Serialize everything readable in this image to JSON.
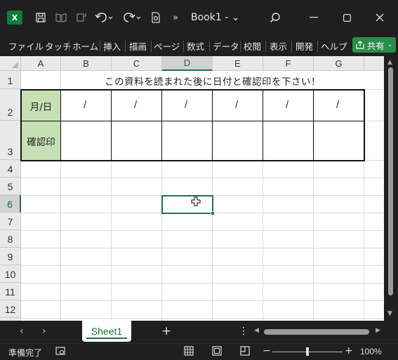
{
  "window": {
    "title": "Book1",
    "title_suffix": "- ⌄",
    "app_letter": "X"
  },
  "ribbon": {
    "tabs": [
      "ファイル",
      "タッチ",
      "ホーム",
      "挿入",
      "描画",
      "ページ",
      "数式",
      "データ",
      "校閲",
      "表示",
      "開発",
      "ヘルプ"
    ],
    "share_label": "共有"
  },
  "columns": [
    "A",
    "B",
    "C",
    "D",
    "E",
    "F",
    "G"
  ],
  "rows": [
    "1",
    "2",
    "3",
    "4",
    "5",
    "6",
    "7",
    "8",
    "9",
    "10",
    "11",
    "12"
  ],
  "selected_column": "D",
  "selected_row": "6",
  "cells": {
    "title_row": "この資料を読まれた後に日付と確認印を下さい！",
    "date_label": "月/日",
    "confirm_label": "確認印",
    "date_slash": "/"
  },
  "colors": {
    "accent": "#217346",
    "label_fill": "#c6e0b4",
    "share_bg": "#2a8c4a"
  },
  "sheet_tabs": [
    "Sheet1"
  ],
  "status": {
    "mode": "準備完了",
    "zoom": "100%"
  },
  "icons": [
    "excel-icon",
    "save-icon",
    "undo-icon",
    "redo-icon",
    "search-icon",
    "minimize-icon",
    "maximize-icon",
    "close-icon",
    "share-icon",
    "normal-view-icon",
    "page-layout-icon",
    "page-break-icon"
  ]
}
